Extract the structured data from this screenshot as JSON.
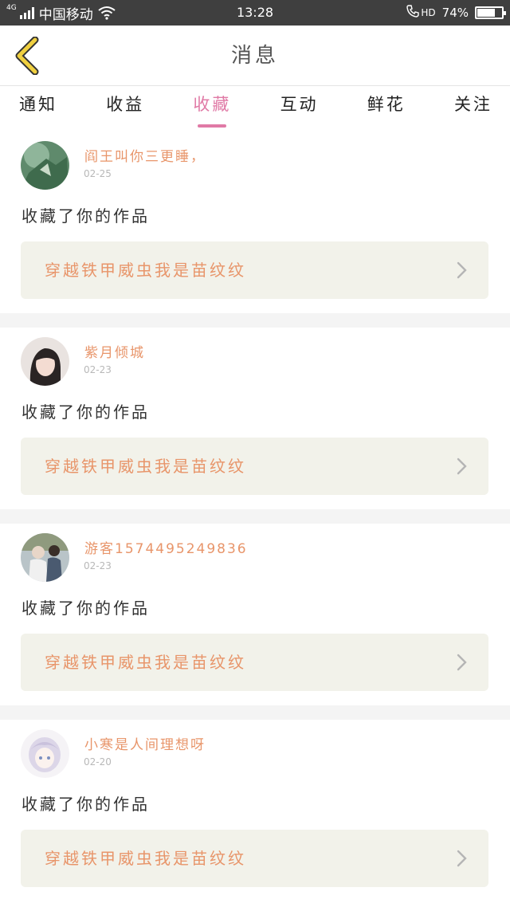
{
  "status_bar": {
    "network": "4G",
    "carrier": "中国移动",
    "time": "13:28",
    "hd": "HD",
    "battery": "74%",
    "battery_level": 0.74
  },
  "header": {
    "title": "消息"
  },
  "tabs": [
    {
      "label": "通知",
      "active": false
    },
    {
      "label": "收益",
      "active": false
    },
    {
      "label": "收藏",
      "active": true
    },
    {
      "label": "互动",
      "active": false
    },
    {
      "label": "鲜花",
      "active": false
    },
    {
      "label": "关注",
      "active": false
    }
  ],
  "messages": [
    {
      "user": "阎王叫你三更睡，",
      "date": "02-25",
      "text": "收藏了你的作品",
      "work": "穿越铁甲威虫我是苗纹纹"
    },
    {
      "user": "紫月倾城",
      "date": "02-23",
      "text": "收藏了你的作品",
      "work": "穿越铁甲威虫我是苗纹纹"
    },
    {
      "user": "游客1574495249836",
      "date": "02-23",
      "text": "收藏了你的作品",
      "work": "穿越铁甲威虫我是苗纹纹"
    },
    {
      "user": "小寒是人间理想呀",
      "date": "02-20",
      "text": "收藏了你的作品",
      "work": "穿越铁甲威虫我是苗纹纹"
    }
  ],
  "colors": {
    "accent": "#e07aa6",
    "name_orange": "#e8956a",
    "back_arrow": "#f0d040",
    "card_bg": "#f2f2ea"
  }
}
